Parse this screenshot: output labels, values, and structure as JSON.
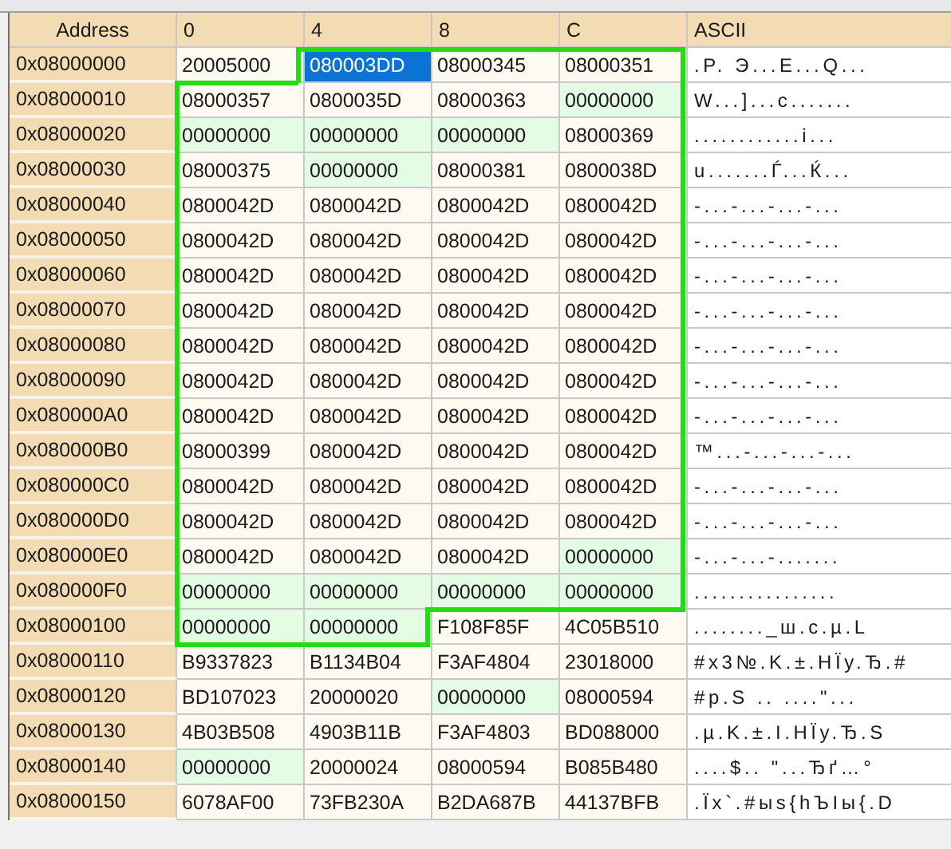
{
  "table": {
    "columns": {
      "address": "Address",
      "hex": [
        "0",
        "4",
        "8",
        "C"
      ],
      "ascii": "ASCII"
    },
    "rows": [
      {
        "address": "0x08000000",
        "cells": [
          {
            "text": "20005000",
            "shaded": false,
            "selected": false
          },
          {
            "text": "080003DD",
            "shaded": false,
            "selected": true
          },
          {
            "text": "08000345",
            "shaded": false,
            "selected": false
          },
          {
            "text": "08000351",
            "shaded": false,
            "selected": false
          }
        ],
        "ascii": ".P.  Э...E...Q..."
      },
      {
        "address": "0x08000010",
        "cells": [
          {
            "text": "08000357",
            "shaded": false,
            "selected": false
          },
          {
            "text": "0800035D",
            "shaded": false,
            "selected": false
          },
          {
            "text": "08000363",
            "shaded": false,
            "selected": false
          },
          {
            "text": "00000000",
            "shaded": true,
            "selected": false
          }
        ],
        "ascii": "W...]...c......."
      },
      {
        "address": "0x08000020",
        "cells": [
          {
            "text": "00000000",
            "shaded": true,
            "selected": false
          },
          {
            "text": "00000000",
            "shaded": true,
            "selected": false
          },
          {
            "text": "00000000",
            "shaded": true,
            "selected": false
          },
          {
            "text": "08000369",
            "shaded": false,
            "selected": false
          }
        ],
        "ascii": "............i..."
      },
      {
        "address": "0x08000030",
        "cells": [
          {
            "text": "08000375",
            "shaded": false,
            "selected": false
          },
          {
            "text": "00000000",
            "shaded": true,
            "selected": false
          },
          {
            "text": "08000381",
            "shaded": false,
            "selected": false
          },
          {
            "text": "0800038D",
            "shaded": false,
            "selected": false
          }
        ],
        "ascii": "u.......Ѓ...Ќ..."
      },
      {
        "address": "0x08000040",
        "cells": [
          {
            "text": "0800042D",
            "shaded": false,
            "selected": false
          },
          {
            "text": "0800042D",
            "shaded": false,
            "selected": false
          },
          {
            "text": "0800042D",
            "shaded": false,
            "selected": false
          },
          {
            "text": "0800042D",
            "shaded": false,
            "selected": false
          }
        ],
        "ascii": "-...-...-...-..."
      },
      {
        "address": "0x08000050",
        "cells": [
          {
            "text": "0800042D",
            "shaded": false,
            "selected": false
          },
          {
            "text": "0800042D",
            "shaded": false,
            "selected": false
          },
          {
            "text": "0800042D",
            "shaded": false,
            "selected": false
          },
          {
            "text": "0800042D",
            "shaded": false,
            "selected": false
          }
        ],
        "ascii": "-...-...-...-..."
      },
      {
        "address": "0x08000060",
        "cells": [
          {
            "text": "0800042D",
            "shaded": false,
            "selected": false
          },
          {
            "text": "0800042D",
            "shaded": false,
            "selected": false
          },
          {
            "text": "0800042D",
            "shaded": false,
            "selected": false
          },
          {
            "text": "0800042D",
            "shaded": false,
            "selected": false
          }
        ],
        "ascii": "-...-...-...-..."
      },
      {
        "address": "0x08000070",
        "cells": [
          {
            "text": "0800042D",
            "shaded": false,
            "selected": false
          },
          {
            "text": "0800042D",
            "shaded": false,
            "selected": false
          },
          {
            "text": "0800042D",
            "shaded": false,
            "selected": false
          },
          {
            "text": "0800042D",
            "shaded": false,
            "selected": false
          }
        ],
        "ascii": "-...-...-...-..."
      },
      {
        "address": "0x08000080",
        "cells": [
          {
            "text": "0800042D",
            "shaded": false,
            "selected": false
          },
          {
            "text": "0800042D",
            "shaded": false,
            "selected": false
          },
          {
            "text": "0800042D",
            "shaded": false,
            "selected": false
          },
          {
            "text": "0800042D",
            "shaded": false,
            "selected": false
          }
        ],
        "ascii": "-...-...-...-..."
      },
      {
        "address": "0x08000090",
        "cells": [
          {
            "text": "0800042D",
            "shaded": false,
            "selected": false
          },
          {
            "text": "0800042D",
            "shaded": false,
            "selected": false
          },
          {
            "text": "0800042D",
            "shaded": false,
            "selected": false
          },
          {
            "text": "0800042D",
            "shaded": false,
            "selected": false
          }
        ],
        "ascii": "-...-...-...-..."
      },
      {
        "address": "0x080000A0",
        "cells": [
          {
            "text": "0800042D",
            "shaded": false,
            "selected": false
          },
          {
            "text": "0800042D",
            "shaded": false,
            "selected": false
          },
          {
            "text": "0800042D",
            "shaded": false,
            "selected": false
          },
          {
            "text": "0800042D",
            "shaded": false,
            "selected": false
          }
        ],
        "ascii": "-...-...-...-..."
      },
      {
        "address": "0x080000B0",
        "cells": [
          {
            "text": "08000399",
            "shaded": false,
            "selected": false
          },
          {
            "text": "0800042D",
            "shaded": false,
            "selected": false
          },
          {
            "text": "0800042D",
            "shaded": false,
            "selected": false
          },
          {
            "text": "0800042D",
            "shaded": false,
            "selected": false
          }
        ],
        "ascii": "™...-...-...-..."
      },
      {
        "address": "0x080000C0",
        "cells": [
          {
            "text": "0800042D",
            "shaded": false,
            "selected": false
          },
          {
            "text": "0800042D",
            "shaded": false,
            "selected": false
          },
          {
            "text": "0800042D",
            "shaded": false,
            "selected": false
          },
          {
            "text": "0800042D",
            "shaded": false,
            "selected": false
          }
        ],
        "ascii": "-...-...-...-..."
      },
      {
        "address": "0x080000D0",
        "cells": [
          {
            "text": "0800042D",
            "shaded": false,
            "selected": false
          },
          {
            "text": "0800042D",
            "shaded": false,
            "selected": false
          },
          {
            "text": "0800042D",
            "shaded": false,
            "selected": false
          },
          {
            "text": "0800042D",
            "shaded": false,
            "selected": false
          }
        ],
        "ascii": "-...-...-...-..."
      },
      {
        "address": "0x080000E0",
        "cells": [
          {
            "text": "0800042D",
            "shaded": false,
            "selected": false
          },
          {
            "text": "0800042D",
            "shaded": false,
            "selected": false
          },
          {
            "text": "0800042D",
            "shaded": false,
            "selected": false
          },
          {
            "text": "00000000",
            "shaded": true,
            "selected": false
          }
        ],
        "ascii": "-...-...-......."
      },
      {
        "address": "0x080000F0",
        "cells": [
          {
            "text": "00000000",
            "shaded": true,
            "selected": false
          },
          {
            "text": "00000000",
            "shaded": true,
            "selected": false
          },
          {
            "text": "00000000",
            "shaded": true,
            "selected": false
          },
          {
            "text": "00000000",
            "shaded": true,
            "selected": false
          }
        ],
        "ascii": "................"
      },
      {
        "address": "0x08000100",
        "cells": [
          {
            "text": "00000000",
            "shaded": true,
            "selected": false
          },
          {
            "text": "00000000",
            "shaded": true,
            "selected": false
          },
          {
            "text": "F108F85F",
            "shaded": false,
            "selected": false
          },
          {
            "text": "4C05B510",
            "shaded": false,
            "selected": false
          }
        ],
        "ascii": "........_ш.c.µ.L"
      },
      {
        "address": "0x08000110",
        "cells": [
          {
            "text": "B9337823",
            "shaded": false,
            "selected": false
          },
          {
            "text": "B1134B04",
            "shaded": false,
            "selected": false
          },
          {
            "text": "F3AF4804",
            "shaded": false,
            "selected": false
          },
          {
            "text": "23018000",
            "shaded": false,
            "selected": false
          }
        ],
        "ascii": "#x3№.K.±.HЇy.Ђ.#"
      },
      {
        "address": "0x08000120",
        "cells": [
          {
            "text": "BD107023",
            "shaded": false,
            "selected": false
          },
          {
            "text": "20000020",
            "shaded": false,
            "selected": false
          },
          {
            "text": "00000000",
            "shaded": true,
            "selected": false
          },
          {
            "text": "08000594",
            "shaded": false,
            "selected": false
          }
        ],
        "ascii": "#p.S  ..  ....\"..."
      },
      {
        "address": "0x08000130",
        "cells": [
          {
            "text": "4B03B508",
            "shaded": false,
            "selected": false
          },
          {
            "text": "4903B11B",
            "shaded": false,
            "selected": false
          },
          {
            "text": "F3AF4803",
            "shaded": false,
            "selected": false
          },
          {
            "text": "BD088000",
            "shaded": false,
            "selected": false
          }
        ],
        "ascii": ".µ.K.±.I.HЇy.Ђ.S"
      },
      {
        "address": "0x08000140",
        "cells": [
          {
            "text": "00000000",
            "shaded": true,
            "selected": false
          },
          {
            "text": "20000024",
            "shaded": false,
            "selected": false
          },
          {
            "text": "08000594",
            "shaded": false,
            "selected": false
          },
          {
            "text": "B085B480",
            "shaded": false,
            "selected": false
          }
        ],
        "ascii": "....$..  \"...Ђґ…°"
      },
      {
        "address": "0x08000150",
        "cells": [
          {
            "text": "6078AF00",
            "shaded": false,
            "selected": false
          },
          {
            "text": "73FB230A",
            "shaded": false,
            "selected": false
          },
          {
            "text": "B2DA687B",
            "shaded": false,
            "selected": false
          },
          {
            "text": "44137BFB",
            "shaded": false,
            "selected": false
          }
        ],
        "ascii": ".Їx`.#ыs{hЪIы{.D"
      }
    ]
  }
}
